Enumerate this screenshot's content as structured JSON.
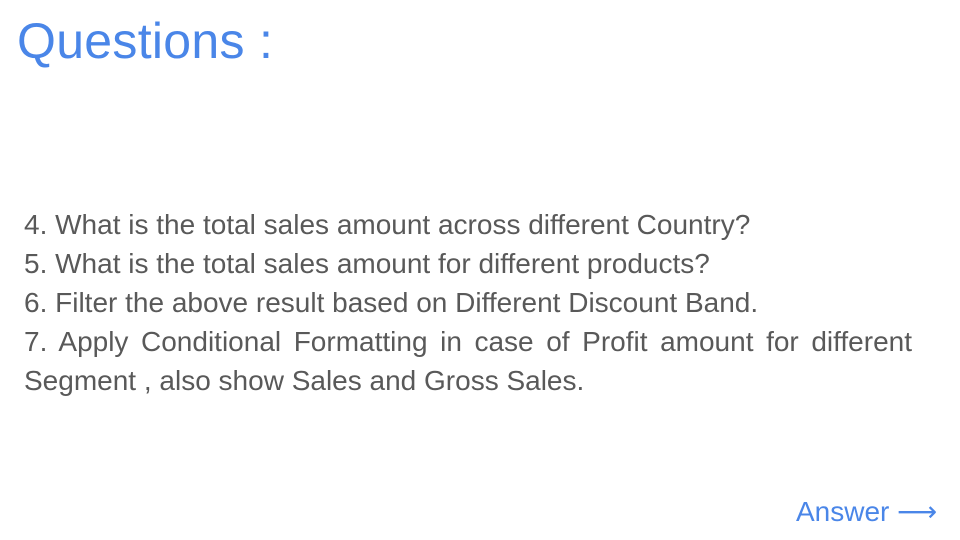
{
  "slide": {
    "title": "Questions :",
    "questions": [
      "4.  What is the total sales amount across different Country?",
      "5.  What is the total sales amount for different products?",
      "6.  Filter the above result based on Different Discount Band.",
      "7. Apply Conditional Formatting in case of Profit amount for different Segment , also show Sales and Gross Sales."
    ],
    "answer_link": "Answer ⟶"
  },
  "colors": {
    "accent": "#4a86e8",
    "body_text": "#595959",
    "background": "#ffffff"
  }
}
